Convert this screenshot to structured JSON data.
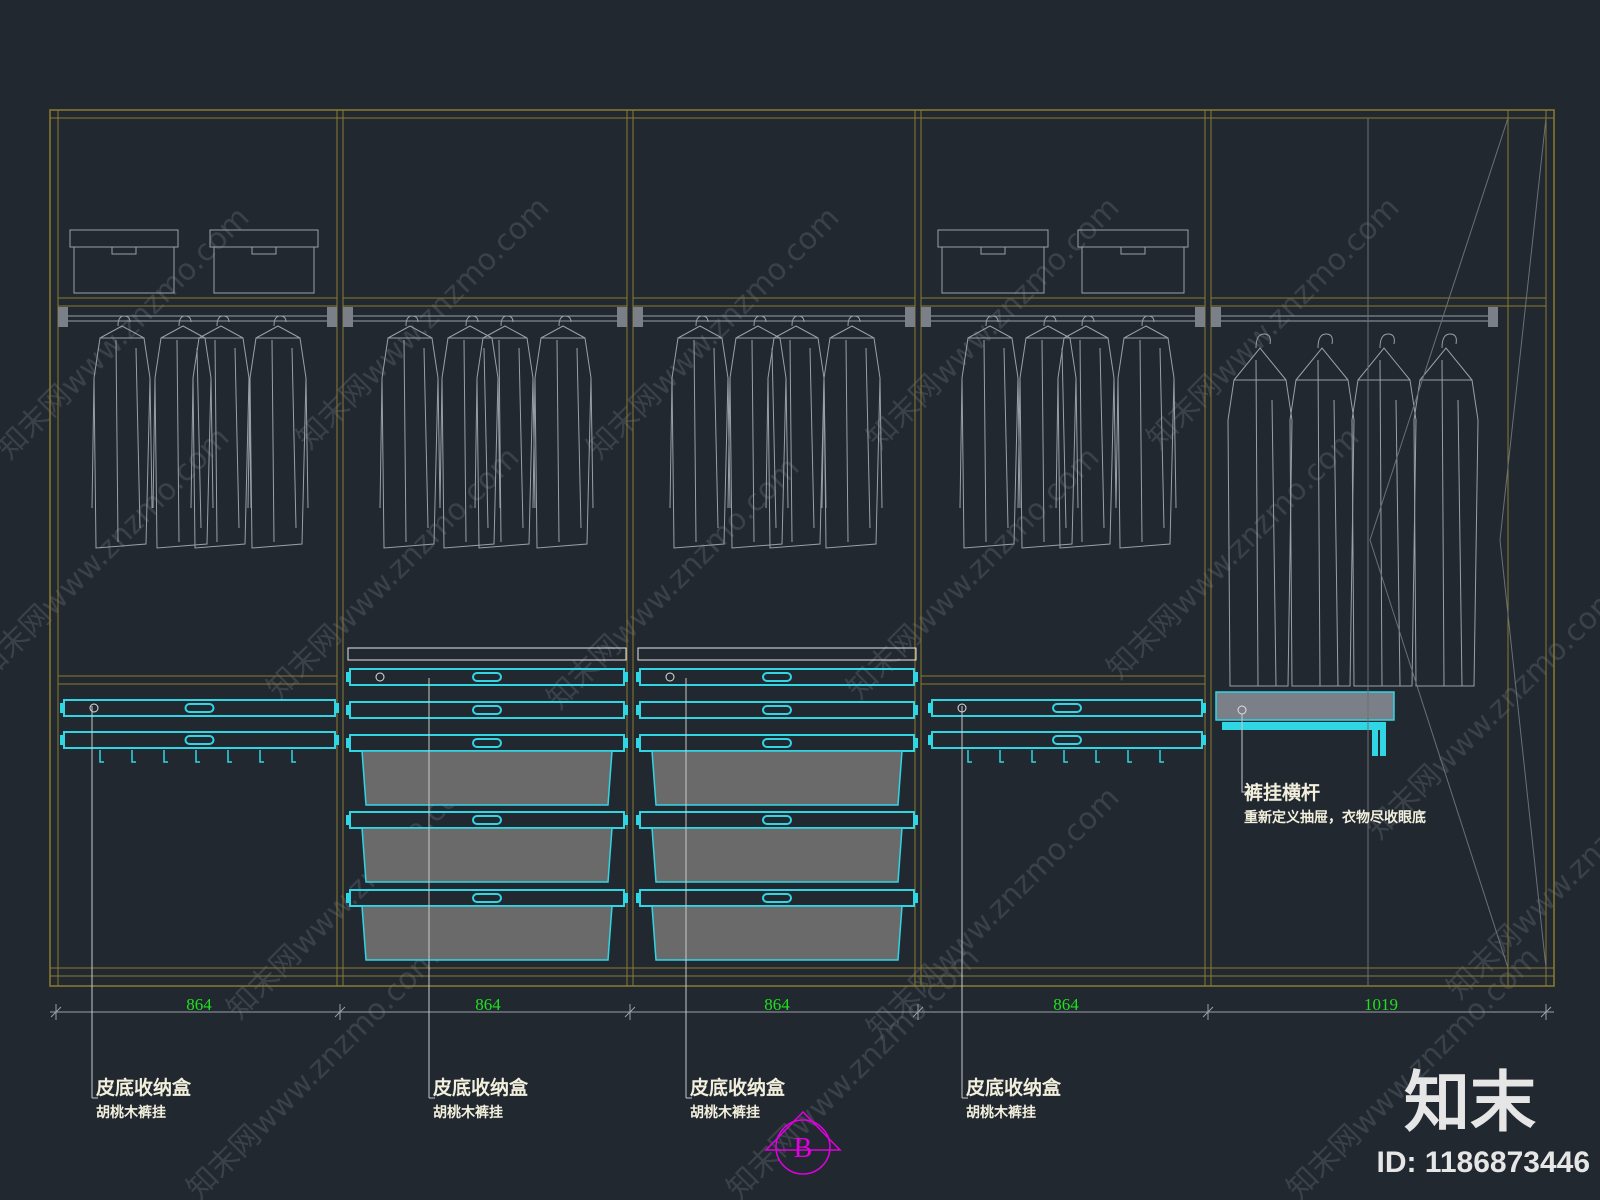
{
  "dimensions": [
    "864",
    "864",
    "864",
    "864",
    "1019"
  ],
  "callouts": [
    {
      "title": "皮底收纳盒",
      "subtitle": "胡桃木裤挂"
    },
    {
      "title": "皮底收纳盒",
      "subtitle": "胡桃木裤挂"
    },
    {
      "title": "皮底收纳盒",
      "subtitle": "胡桃木裤挂"
    },
    {
      "title": "皮底收纳盒",
      "subtitle": "胡桃木裤挂"
    }
  ],
  "rail_note": {
    "title": "裤挂横杆",
    "subtitle": "重新定义抽屉，衣物尽收眼底"
  },
  "section_marker": "B",
  "watermark": {
    "text": "知末网www.znzmo.com"
  },
  "brand": {
    "name": "知末",
    "id": "ID: 1186873446"
  },
  "colors": {
    "background": "#212830",
    "frame": "#8c7a2e",
    "hardware": "#31d6e4",
    "clothes": "#9aa0a8",
    "dimension": "#1fe01f",
    "marker": "#e000e0",
    "label": "#f2efdc"
  }
}
